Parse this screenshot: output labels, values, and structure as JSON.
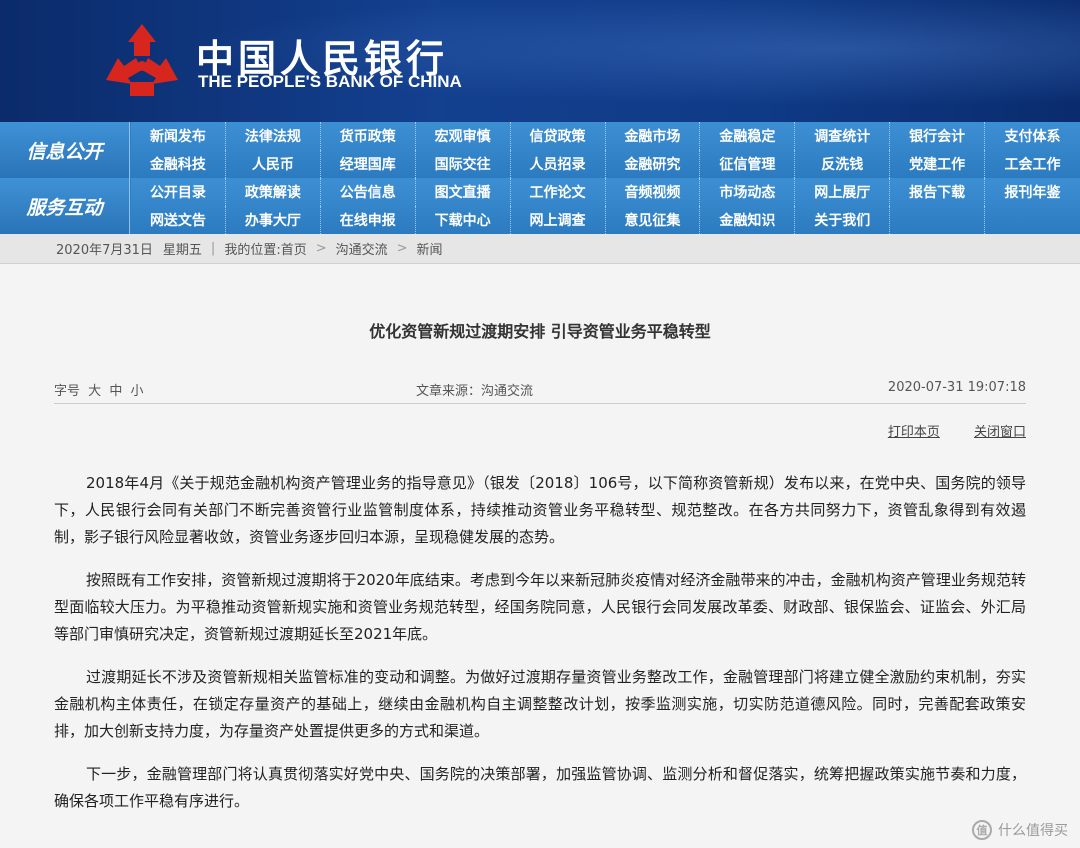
{
  "header": {
    "logo_cn": "中国人民银行",
    "logo_en": "THE PEOPLE'S BANK OF CHINA",
    "logo_color": "#d7261e"
  },
  "nav": {
    "row1_label": "信息公开",
    "row1_items": [
      "新闻发布",
      "法律法规",
      "货币政策",
      "宏观审慎",
      "信贷政策",
      "金融市场",
      "金融稳定",
      "调查统计",
      "银行会计",
      "支付体系",
      "金融科技",
      "人民币",
      "经理国库",
      "国际交往",
      "人员招录",
      "金融研究",
      "征信管理",
      "反洗钱",
      "党建工作",
      "工会工作"
    ],
    "row2_label": "服务互动",
    "row2_items": [
      "公开目录",
      "政策解读",
      "公告信息",
      "图文直播",
      "工作论文",
      "音频视频",
      "市场动态",
      "网上展厅",
      "报告下载",
      "报刊年鉴",
      "网送文告",
      "办事大厅",
      "在线申报",
      "下载中心",
      "网上调查",
      "意见征集",
      "金融知识",
      "关于我们",
      "",
      ""
    ]
  },
  "breadcrumb": {
    "date": "2020年7月31日",
    "weekday": "星期五",
    "location_label": "我的位置:",
    "crumbs": [
      "首页",
      "沟通交流",
      "新闻"
    ]
  },
  "article": {
    "title": "优化资管新规过渡期安排 引导资管业务平稳转型",
    "font_size_label": "字号",
    "font_sizes": [
      "大",
      "中",
      "小"
    ],
    "source": "文章来源：沟通交流",
    "datetime": "2020-07-31 19:07:18",
    "print_label": "打印本页",
    "close_label": "关闭窗口",
    "paragraphs": [
      "2018年4月《关于规范金融机构资产管理业务的指导意见》（银发〔2018〕106号，以下简称资管新规）发布以来，在党中央、国务院的领导下，人民银行会同有关部门不断完善资管行业监管制度体系，持续推动资管业务平稳转型、规范整改。在各方共同努力下，资管乱象得到有效遏制，影子银行风险显著收敛，资管业务逐步回归本源，呈现稳健发展的态势。",
      "按照既有工作安排，资管新规过渡期将于2020年底结束。考虑到今年以来新冠肺炎疫情对经济金融带来的冲击，金融机构资产管理业务规范转型面临较大压力。为平稳推动资管新规实施和资管业务规范转型，经国务院同意，人民银行会同发展改革委、财政部、银保监会、证监会、外汇局等部门审慎研究决定，资管新规过渡期延长至2021年底。",
      "过渡期延长不涉及资管新规相关监管标准的变动和调整。为做好过渡期存量资管业务整改工作，金融管理部门将建立健全激励约束机制，夯实金融机构主体责任，在锁定存量资产的基础上，继续由金融机构自主调整整改计划，按季监测实施，切实防范道德风险。同时，完善配套政策安排，加大创新支持力度，为存量资产处置提供更多的方式和渠道。",
      "下一步，金融管理部门将认真贯彻落实好党中央、国务院的决策部署，加强监管协调、监测分析和督促落实，统筹把握政策实施节奏和力度，确保各项工作平稳有序进行。"
    ]
  },
  "watermark": {
    "icon_text": "值",
    "text": "什么值得买"
  }
}
